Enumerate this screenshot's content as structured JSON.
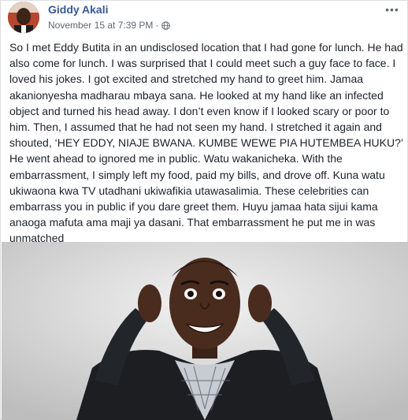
{
  "post": {
    "author_name": "Giddy Akali",
    "timestamp": "November 15 at 7:39 PM",
    "separator": "·",
    "privacy_icon": "globe-icon",
    "more_icon": "ellipsis-icon",
    "more_glyph": "•••",
    "body": "So I met Eddy Butita in an undisclosed location that I had gone for lunch. He had also come for lunch. I was surprised that I could meet such a guy face to face. I loved his jokes. I got excited and stretched my hand to greet him. Jamaa akanionyesha madharau mbaya sana. He looked at my hand like an infected object and turned his head away. I don’t even know if I looked scary or poor to him. Then, I assumed that he had not seen my hand. I stretched it again and shouted, ‘HEY EDDY, NIAJE BWANA. KUMBE WEWE PIA HUTEMBEA HUKU?’ He went ahead to ignored me in public. Watu wakanicheka. With the embarrassment, I simply left my food, paid my bills, and drove off. Kuna watu ukiwaona kwa TV utadhani ukiwafikia utawasalimia. These celebrities can embarrass you in public if you dare greet them. Huyu jamaa hata sijui kama anaoga mafuta ama maji ya dasani. That embarrassment he put me in was unmatched"
  },
  "colors": {
    "author": "#385898",
    "meta": "#616770",
    "text": "#1d2129",
    "border": "#dddfe2"
  }
}
